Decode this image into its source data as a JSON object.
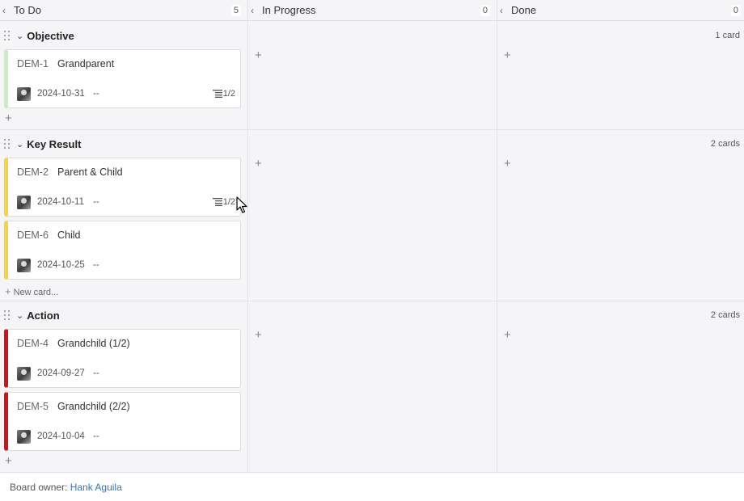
{
  "columns": [
    {
      "title": "To Do",
      "count": "5"
    },
    {
      "title": "In Progress",
      "count": "0"
    },
    {
      "title": "Done",
      "count": "0"
    }
  ],
  "lanes": [
    {
      "name": "Objective",
      "count": "1 card",
      "color": "#cdeac0",
      "cards": [
        {
          "key": "DEM-1",
          "title": "Grandparent",
          "date": "2024-10-31",
          "dash": "--",
          "subtasks": "1/2"
        }
      ]
    },
    {
      "name": "Key Result",
      "count": "2 cards",
      "color": "#f5d442",
      "cards": [
        {
          "key": "DEM-2",
          "title": "Parent & Child",
          "date": "2024-10-11",
          "dash": "--",
          "subtasks": "1/2"
        },
        {
          "key": "DEM-6",
          "title": "Child",
          "date": "2024-10-25",
          "dash": "--"
        }
      ],
      "new_card_label": "New card..."
    },
    {
      "name": "Action",
      "count": "2 cards",
      "color": "#d0121b",
      "cards": [
        {
          "key": "DEM-4",
          "title": "Grandchild (1/2)",
          "date": "2024-09-27",
          "dash": "--"
        },
        {
          "key": "DEM-5",
          "title": "Grandchild (2/2)",
          "date": "2024-10-04",
          "dash": "--"
        }
      ]
    }
  ],
  "footer": {
    "label": "Board owner:",
    "owner": "Hank Aguila"
  }
}
